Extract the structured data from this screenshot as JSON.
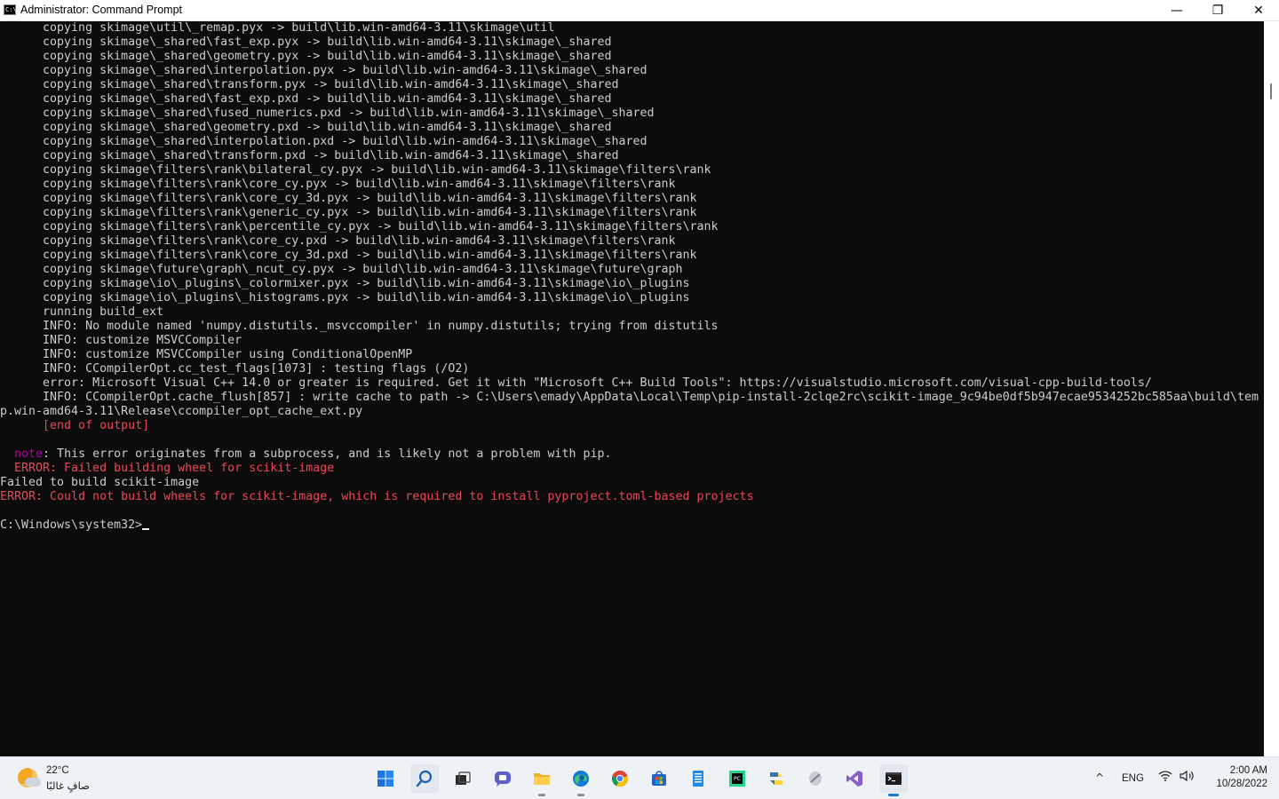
{
  "window": {
    "title": "Administrator: Command Prompt",
    "icon_label": "C:\\",
    "minimize_icon": "—",
    "maximize_icon": "❐",
    "close_icon": "✕"
  },
  "console": {
    "lines": [
      {
        "text": "      copying skimage\\util\\_remap.pyx -> build\\lib.win-amd64-3.11\\skimage\\util",
        "color": "gray"
      },
      {
        "text": "      copying skimage\\_shared\\fast_exp.pyx -> build\\lib.win-amd64-3.11\\skimage\\_shared",
        "color": "gray"
      },
      {
        "text": "      copying skimage\\_shared\\geometry.pyx -> build\\lib.win-amd64-3.11\\skimage\\_shared",
        "color": "gray"
      },
      {
        "text": "      copying skimage\\_shared\\interpolation.pyx -> build\\lib.win-amd64-3.11\\skimage\\_shared",
        "color": "gray"
      },
      {
        "text": "      copying skimage\\_shared\\transform.pyx -> build\\lib.win-amd64-3.11\\skimage\\_shared",
        "color": "gray"
      },
      {
        "text": "      copying skimage\\_shared\\fast_exp.pxd -> build\\lib.win-amd64-3.11\\skimage\\_shared",
        "color": "gray"
      },
      {
        "text": "      copying skimage\\_shared\\fused_numerics.pxd -> build\\lib.win-amd64-3.11\\skimage\\_shared",
        "color": "gray"
      },
      {
        "text": "      copying skimage\\_shared\\geometry.pxd -> build\\lib.win-amd64-3.11\\skimage\\_shared",
        "color": "gray"
      },
      {
        "text": "      copying skimage\\_shared\\interpolation.pxd -> build\\lib.win-amd64-3.11\\skimage\\_shared",
        "color": "gray"
      },
      {
        "text": "      copying skimage\\_shared\\transform.pxd -> build\\lib.win-amd64-3.11\\skimage\\_shared",
        "color": "gray"
      },
      {
        "text": "      copying skimage\\filters\\rank\\bilateral_cy.pyx -> build\\lib.win-amd64-3.11\\skimage\\filters\\rank",
        "color": "gray"
      },
      {
        "text": "      copying skimage\\filters\\rank\\core_cy.pyx -> build\\lib.win-amd64-3.11\\skimage\\filters\\rank",
        "color": "gray"
      },
      {
        "text": "      copying skimage\\filters\\rank\\core_cy_3d.pyx -> build\\lib.win-amd64-3.11\\skimage\\filters\\rank",
        "color": "gray"
      },
      {
        "text": "      copying skimage\\filters\\rank\\generic_cy.pyx -> build\\lib.win-amd64-3.11\\skimage\\filters\\rank",
        "color": "gray"
      },
      {
        "text": "      copying skimage\\filters\\rank\\percentile_cy.pyx -> build\\lib.win-amd64-3.11\\skimage\\filters\\rank",
        "color": "gray"
      },
      {
        "text": "      copying skimage\\filters\\rank\\core_cy.pxd -> build\\lib.win-amd64-3.11\\skimage\\filters\\rank",
        "color": "gray"
      },
      {
        "text": "      copying skimage\\filters\\rank\\core_cy_3d.pxd -> build\\lib.win-amd64-3.11\\skimage\\filters\\rank",
        "color": "gray"
      },
      {
        "text": "      copying skimage\\future\\graph\\_ncut_cy.pyx -> build\\lib.win-amd64-3.11\\skimage\\future\\graph",
        "color": "gray"
      },
      {
        "text": "      copying skimage\\io\\_plugins\\_colormixer.pyx -> build\\lib.win-amd64-3.11\\skimage\\io\\_plugins",
        "color": "gray"
      },
      {
        "text": "      copying skimage\\io\\_plugins\\_histograms.pyx -> build\\lib.win-amd64-3.11\\skimage\\io\\_plugins",
        "color": "gray"
      },
      {
        "text": "      running build_ext",
        "color": "gray"
      },
      {
        "text": "      INFO: No module named 'numpy.distutils._msvccompiler' in numpy.distutils; trying from distutils",
        "color": "gray"
      },
      {
        "text": "      INFO: customize MSVCCompiler",
        "color": "gray"
      },
      {
        "text": "      INFO: customize MSVCCompiler using ConditionalOpenMP",
        "color": "gray"
      },
      {
        "text": "      INFO: CCompilerOpt.cc_test_flags[1073] : testing flags (/O2)",
        "color": "gray"
      },
      {
        "text": "      error: Microsoft Visual C++ 14.0 or greater is required. Get it with \"Microsoft C++ Build Tools\": https://visualstudio.microsoft.com/visual-cpp-build-tools/",
        "color": "gray"
      },
      {
        "text": "      INFO: CCompilerOpt.cache_flush[857] : write cache to path -> C:\\Users\\emady\\AppData\\Local\\Temp\\pip-install-2clqe2rc\\scikit-image_9c94be0df5b947ecae9534252bc585aa\\build\\tem",
        "color": "gray"
      },
      {
        "text": "p.win-amd64-3.11\\Release\\ccompiler_opt_cache_ext.py",
        "color": "gray"
      },
      {
        "text": "      [end of output]",
        "color": "red"
      },
      {
        "text": "",
        "color": "gray"
      },
      {
        "text": "  note: This error originates from a subprocess, and is likely not a problem with pip.",
        "color": "note"
      },
      {
        "text": "  ERROR: Failed building wheel for scikit-image",
        "color": "red"
      },
      {
        "text": "Failed to build scikit-image",
        "color": "gray"
      },
      {
        "text": "ERROR: Could not build wheels for scikit-image, which is required to install pyproject.toml-based projects",
        "color": "red"
      },
      {
        "text": "",
        "color": "gray"
      }
    ],
    "note_prefix": "  note",
    "note_rest": ": This error originates from a subprocess, and is likely not a problem with pip.",
    "prompt": "C:\\Windows\\system32>"
  },
  "taskbar": {
    "weather": {
      "temp": "22°C",
      "condition": "صافٍ غالبًا"
    },
    "apps": [
      {
        "name": "start-button",
        "icon": "windows-logo-icon"
      },
      {
        "name": "search-button",
        "icon": "search-icon"
      },
      {
        "name": "task-view-button",
        "icon": "task-view-icon"
      },
      {
        "name": "chat-button",
        "icon": "chat-icon"
      },
      {
        "name": "file-explorer-button",
        "icon": "folder-icon"
      },
      {
        "name": "edge-button",
        "icon": "edge-icon"
      },
      {
        "name": "chrome-button",
        "icon": "chrome-icon"
      },
      {
        "name": "store-button",
        "icon": "store-icon"
      },
      {
        "name": "notepad-button",
        "icon": "notepad-icon"
      },
      {
        "name": "pycharm-button",
        "icon": "pycharm-icon"
      },
      {
        "name": "python-button",
        "icon": "python-icon"
      },
      {
        "name": "tool-button",
        "icon": "tool-icon"
      },
      {
        "name": "visual-studio-button",
        "icon": "visual-studio-icon"
      },
      {
        "name": "terminal-button",
        "icon": "terminal-icon"
      }
    ],
    "tray": {
      "chevron": "^",
      "language": "ENG",
      "wifi": "wifi-icon",
      "volume": "volume-icon"
    },
    "clock": {
      "time": "2:00 AM",
      "date": "10/28/2022"
    }
  },
  "colors": {
    "console_bg": "#0c0c0c",
    "console_text": "#cccccc",
    "error_red": "#e74856",
    "note_magenta": "#b4009e",
    "taskbar_bg": "#eef1f6"
  }
}
